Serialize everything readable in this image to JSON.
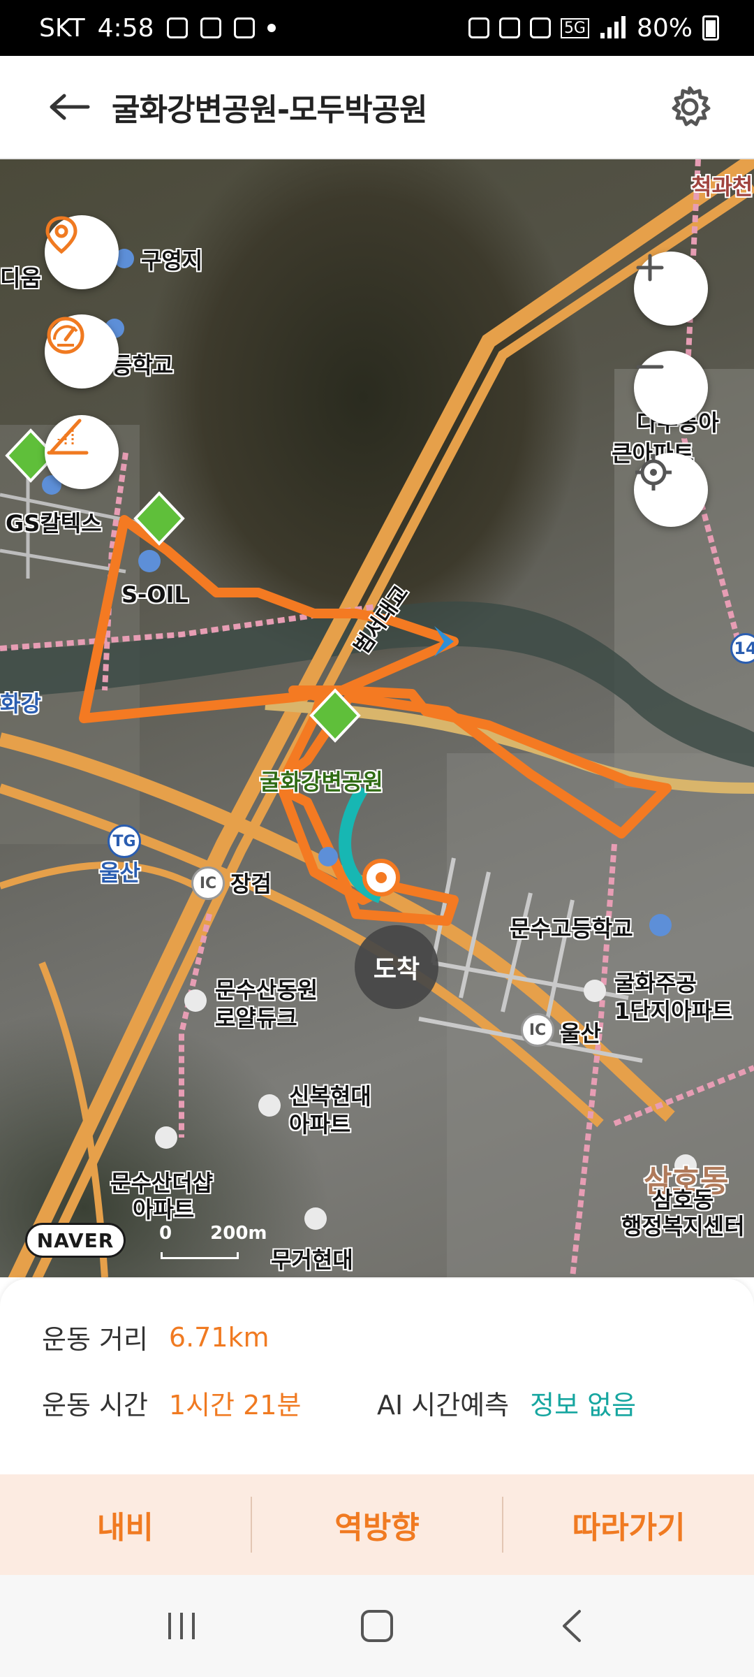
{
  "status_bar": {
    "carrier": "SKT",
    "time": "4:58",
    "network": "5G",
    "battery": "80%"
  },
  "header": {
    "title": "굴화강변공원-모두박공원",
    "back_icon": "arrow-left-icon",
    "settings_icon": "gear-icon"
  },
  "map": {
    "labels": {
      "guyeongji": "구영지",
      "school": "등학교",
      "diyum": "디움",
      "gs": "GS칼텍스",
      "soil": "S-OIL",
      "river": "화강",
      "park": "굴화강변공원",
      "ulsan_tg": "울산",
      "jangeom": "장검",
      "munsu_high": "문수고등학교",
      "gulhwa_apt1": "굴화주공",
      "gulhwa_apt2": "1단지아파트",
      "munsusan_royal1": "문수산동원",
      "munsusan_royal2": "로얄듀크",
      "sinbok1": "신복현대",
      "sinbok2": "아파트",
      "ulsan_ic": "울산",
      "munsusan_sharp1": "문수산더샵",
      "munsusan_sharp2": "아파트",
      "samho_dong": "삼호동",
      "samho_center1": "삼호동",
      "samho_center2": "행정복지센터",
      "mugeo": "무거현대",
      "jeokgwa": "척과천",
      "daeu1": "다우동아",
      "daeu2": "큰아파트",
      "bumseo": "범서대교",
      "route_14": "14",
      "tg_badge": "TG",
      "ic_badge1": "IC",
      "ic_badge2": "IC"
    },
    "arrive_badge": "도착",
    "naver_logo": "NAVER",
    "scale": {
      "zero": "0",
      "distance": "200m"
    },
    "route_color": "#f47a22",
    "buttons": {
      "location_icon": "location-pin-icon",
      "speedometer_icon": "speedometer-icon",
      "elevation_icon": "elevation-icon",
      "zoom_in_icon": "plus-icon",
      "zoom_out_icon": "minus-icon",
      "my_location_icon": "crosshair-icon"
    }
  },
  "summary": {
    "distance_label": "운동 거리",
    "distance_value": "6.71km",
    "time_label": "운동 시간",
    "time_value": "1시간 21분",
    "ai_label": "AI 시간예측",
    "ai_value": "정보 없음"
  },
  "actions": {
    "navi": "내비",
    "reverse": "역방향",
    "follow": "따라가기"
  },
  "nav_bar": {
    "recent_icon": "recent-apps-icon",
    "home_icon": "home-icon",
    "back_icon": "back-chevron-icon"
  },
  "colors": {
    "accent": "#f07a21",
    "teal": "#16a6a0",
    "action_bg": "#fcebe1"
  }
}
